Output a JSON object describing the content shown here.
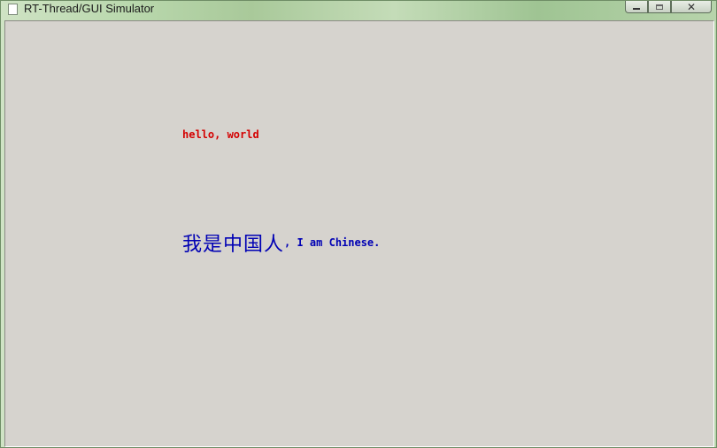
{
  "window": {
    "title": "RT-Thread/GUI Simulator",
    "controls": {
      "minimize_icon": "minimize-icon",
      "maximize_icon": "maximize-icon",
      "close_icon": "close-icon",
      "close_glyph": "✕"
    }
  },
  "canvas": {
    "background_color": "#d6d3ce",
    "hello_text": "hello, world",
    "hello_color": "#d40000",
    "chinese_text": "我是中国人",
    "english_text": ", I am Chinese.",
    "chinese_color": "#0000b4"
  }
}
